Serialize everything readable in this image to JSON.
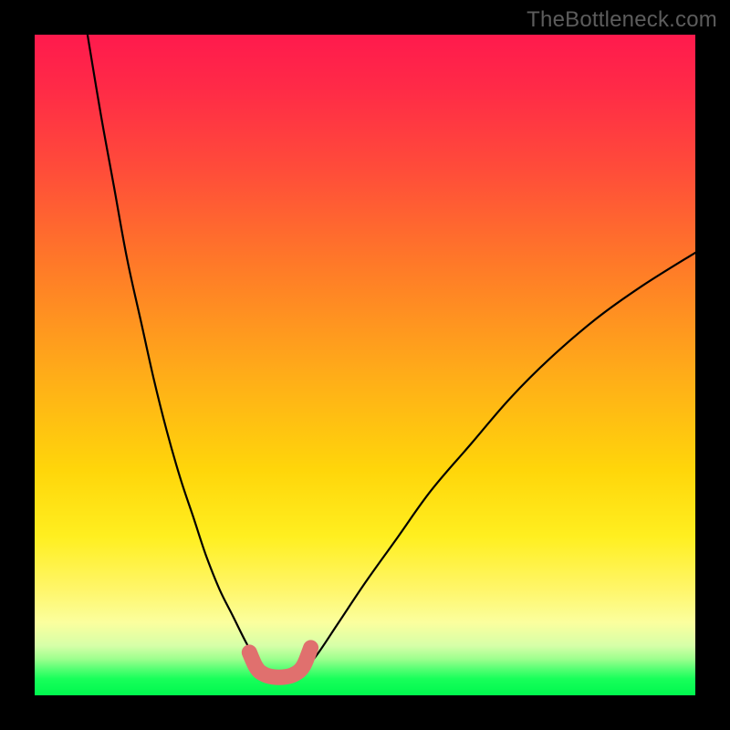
{
  "watermark": "TheBottleneck.com",
  "chart_data": {
    "type": "line",
    "title": "",
    "xlabel": "",
    "ylabel": "",
    "xlim": [
      0,
      100
    ],
    "ylim": [
      0,
      100
    ],
    "grid": false,
    "legend": false,
    "series": [
      {
        "name": "black-curve-left",
        "color": "#000000",
        "x": [
          8,
          10,
          12,
          14,
          16,
          18,
          20,
          22,
          24,
          26,
          28,
          30,
          32,
          33.5,
          35
        ],
        "y": [
          100,
          88,
          77,
          66,
          57,
          48,
          40,
          33,
          27,
          21,
          16,
          12,
          8,
          5.5,
          4
        ]
      },
      {
        "name": "black-curve-right",
        "color": "#000000",
        "x": [
          41,
          43,
          46,
          50,
          55,
          60,
          66,
          72,
          78,
          85,
          92,
          100
        ],
        "y": [
          4,
          6.5,
          11,
          17,
          24,
          31,
          38,
          45,
          51,
          57,
          62,
          67
        ]
      },
      {
        "name": "pink-floor-marker",
        "color": "#e0706e",
        "x": [
          32.5,
          33.5,
          34.5,
          36,
          38,
          39.5,
          40.7,
          41.8
        ],
        "y": [
          6.5,
          4.3,
          3.3,
          2.8,
          2.8,
          3.3,
          4.5,
          7.2
        ]
      }
    ],
    "background_gradient": {
      "direction": "vertical",
      "stops": [
        {
          "pos": 0.0,
          "color": "#ff1a4d"
        },
        {
          "pos": 0.2,
          "color": "#ff4b3a"
        },
        {
          "pos": 0.5,
          "color": "#ffb316"
        },
        {
          "pos": 0.78,
          "color": "#fff23a"
        },
        {
          "pos": 0.93,
          "color": "#c8ffa0"
        },
        {
          "pos": 1.0,
          "color": "#00f84e"
        }
      ]
    }
  }
}
